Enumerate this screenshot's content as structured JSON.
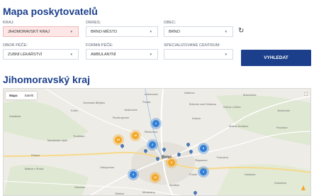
{
  "page": {
    "title": "Mapa poskytovatelů",
    "region_title": "Jihomoravský kraj"
  },
  "filters": {
    "kraj": {
      "label": "KRAJ:",
      "value": "JIHOMORAVSKÝ KRAJ"
    },
    "okres": {
      "label": "OKRES:",
      "value": "BRNO-MĚSTO"
    },
    "obec": {
      "label": "OBEC:",
      "value": "BRNO"
    },
    "obor": {
      "label": "OBOR PÉČE:",
      "value": "ZUBNÍ LÉKAŘSTVÍ"
    },
    "forma": {
      "label": "FORMA PÉČE:",
      "value": "AMBULANTNÍ"
    },
    "centrum": {
      "label": "SPECIALIZOVANÉ CENTRUM:",
      "value": ""
    }
  },
  "search_button": "VYHLEDAT",
  "map": {
    "type_buttons": [
      "Mapa",
      "Satelit"
    ],
    "places": [
      "Lelekovice",
      "Adamov",
      "Bukovinka",
      "Veverská Bítýška",
      "Česká",
      "Jinačovice",
      "Kuřim",
      "Rozdrojovice",
      "Bílovice nad Svitavou",
      "Ochoz u Brna",
      "Řečkovice",
      "Zastávka",
      "Troubsko",
      "Brno",
      "Šlapanice",
      "Rosice",
      "Ostopovice",
      "Podolí",
      "Tvarožná",
      "Modřice",
      "Moravany",
      "Střelice",
      "Ořechov",
      "Kanice",
      "Mokrá-Horákov",
      "Pozořice",
      "Mariánské údolí",
      "Jedovnice",
      "Babice u Rosic",
      "Holubice",
      "Sokolnice"
    ],
    "clusters": [
      {
        "value": "1",
        "color": "blue"
      },
      {
        "value": "16",
        "color": "orange"
      },
      {
        "value": "59",
        "color": "orange"
      },
      {
        "value": "5",
        "color": "blue"
      },
      {
        "value": "2",
        "color": "blue"
      },
      {
        "value": "8",
        "color": "orange"
      },
      {
        "value": "3",
        "color": "blue"
      },
      {
        "value": "14",
        "color": "orange"
      },
      {
        "value": "2",
        "color": "blue"
      }
    ]
  }
}
